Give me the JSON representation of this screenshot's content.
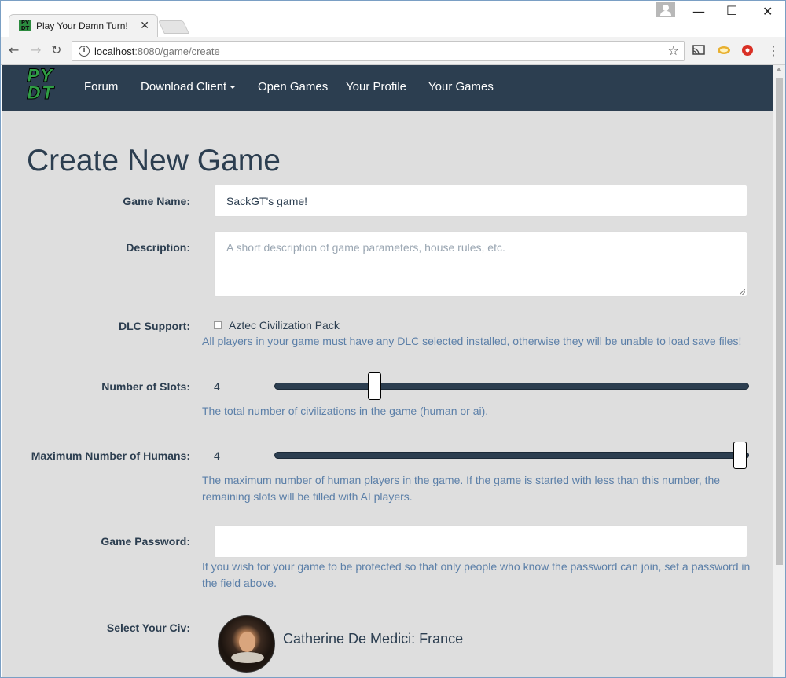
{
  "browser": {
    "tab_title": "Play Your Damn Turn!",
    "tab_close": "✕",
    "favicon_text": "PYDT",
    "url_host": "localhost",
    "url_path": ":8080/game/create",
    "window_controls": {
      "minimize": "—",
      "maximize": "☐",
      "close": "✕"
    },
    "nav": {
      "back": "←",
      "forward": "→",
      "reload": "↻",
      "star": "☆",
      "menu": "⋮"
    }
  },
  "site_nav": {
    "logo_line1": "PY",
    "logo_line2": "DT",
    "items": [
      {
        "label": "Forum"
      },
      {
        "label": "Download Client"
      },
      {
        "label": "Open Games"
      },
      {
        "label": "Your Profile"
      },
      {
        "label": "Your Games"
      }
    ]
  },
  "page": {
    "title": "Create New Game",
    "game_name": {
      "label": "Game Name:",
      "value": "SackGT's game!"
    },
    "description": {
      "label": "Description:",
      "placeholder": "A short description of game parameters, house rules, etc."
    },
    "dlc": {
      "label": "DLC Support:",
      "option": "Aztec Civilization Pack",
      "checked": false,
      "help": "All players in your game must have any DLC selected installed, otherwise they will be unable to load save files!"
    },
    "slots": {
      "label": "Number of Slots:",
      "value": "4",
      "slider_fraction": 0.2,
      "help": "The total number of civilizations in the game (human or ai)."
    },
    "humans": {
      "label": "Maximum Number of Humans:",
      "value": "4",
      "slider_fraction": 1.0,
      "help_line1": "The maximum number of human players in the game. If the game is started with less than this number, the",
      "help_line2": "remaining slots will be filled with AI players."
    },
    "password": {
      "label": "Game Password:",
      "value": "",
      "help_line1": "If you wish for your game to be protected so that only people who know the password can join, set a password in",
      "help_line2": "the field above."
    },
    "civ": {
      "label": "Select Your Civ:",
      "name": "Catherine De Medici: France"
    }
  },
  "colors": {
    "navbar": "#2c3e50",
    "page_bg": "#dedede",
    "help_text": "#5b7fa8",
    "logo_green": "#2f9e44"
  }
}
